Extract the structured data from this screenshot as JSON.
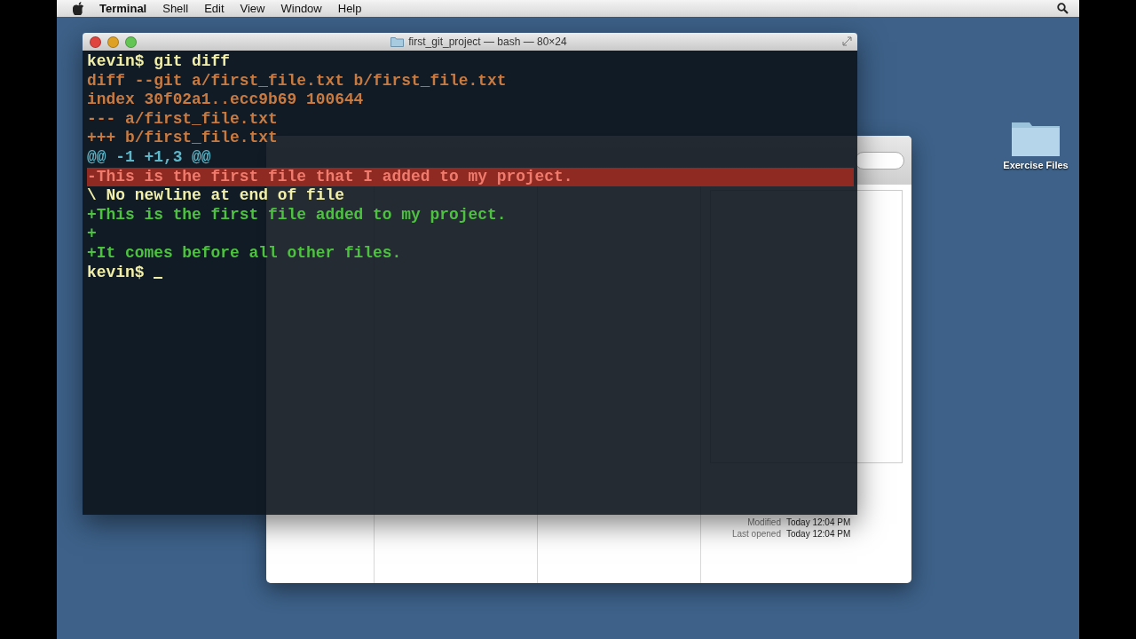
{
  "menu_bar": {
    "items": [
      {
        "label": "Terminal",
        "kind": "app"
      },
      {
        "label": "Shell",
        "kind": "menu"
      },
      {
        "label": "Edit",
        "kind": "menu"
      },
      {
        "label": "View",
        "kind": "menu"
      },
      {
        "label": "Window",
        "kind": "menu"
      },
      {
        "label": "Help",
        "kind": "menu"
      }
    ]
  },
  "finder": {
    "info": [
      {
        "label": "Modified",
        "value": "Today 12:04 PM"
      },
      {
        "label": "Last opened",
        "value": "Today 12:04 PM"
      }
    ]
  },
  "terminal": {
    "title": "first_git_project — bash — 80×24",
    "cursor": true,
    "lines": [
      {
        "kind": "prompt",
        "text": "kevin$ git diff"
      },
      {
        "kind": "meta",
        "text": "diff --git a/first_file.txt b/first_file.txt"
      },
      {
        "kind": "meta",
        "text": "index 30f02a1..ecc9b69 100644"
      },
      {
        "kind": "meta",
        "text": "--- a/first_file.txt"
      },
      {
        "kind": "meta",
        "text": "+++ b/first_file.txt"
      },
      {
        "kind": "hunk",
        "text": "@@ -1 +1,3 @@"
      },
      {
        "kind": "removed",
        "text": "-This is the first file that I added to my project."
      },
      {
        "kind": "note",
        "text": "\\ No newline at end of file"
      },
      {
        "kind": "added",
        "text": "+This is the first file added to my project."
      },
      {
        "kind": "added",
        "text": "+"
      },
      {
        "kind": "added",
        "text": "+It comes before all other files."
      },
      {
        "kind": "prompt",
        "text": "kevin$ "
      }
    ]
  },
  "desktop": {
    "icons": [
      {
        "label": "Exercise Files"
      }
    ]
  }
}
